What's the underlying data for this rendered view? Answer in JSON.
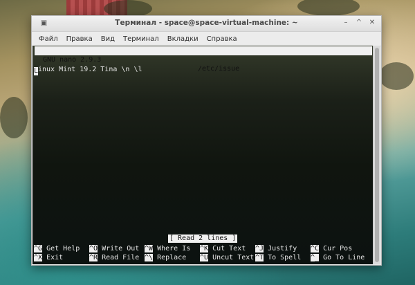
{
  "window": {
    "title": "Терминал - space@space-virtual-machine: ~",
    "icon": "terminal-icon"
  },
  "menubar": {
    "items": [
      "Файл",
      "Правка",
      "Вид",
      "Терминал",
      "Вкладки",
      "Справка"
    ]
  },
  "nano": {
    "version": "GNU nano 2.9.3",
    "filename": "/etc/issue",
    "content_line": "inux Mint 19.2 Tina \\n \\l",
    "cursor_char": "L",
    "status": "[ Read 2 lines ]",
    "shortcuts_row1": [
      {
        "key": "^G",
        "label": "Get Help"
      },
      {
        "key": "^O",
        "label": "Write Out"
      },
      {
        "key": "^W",
        "label": "Where Is"
      },
      {
        "key": "^K",
        "label": "Cut Text"
      },
      {
        "key": "^J",
        "label": "Justify"
      },
      {
        "key": "^C",
        "label": "Cur Pos"
      }
    ],
    "shortcuts_row2": [
      {
        "key": "^X",
        "label": "Exit"
      },
      {
        "key": "^R",
        "label": "Read File"
      },
      {
        "key": "^\\",
        "label": "Replace"
      },
      {
        "key": "^U",
        "label": "Uncut Text"
      },
      {
        "key": "^T",
        "label": "To Spell"
      },
      {
        "key": "^_",
        "label": "Go To Line"
      }
    ]
  },
  "colors": {
    "terminal_bg": "#10150f",
    "terminal_fg": "#e6e6e6",
    "inverse_bg": "#f0f0f0"
  }
}
